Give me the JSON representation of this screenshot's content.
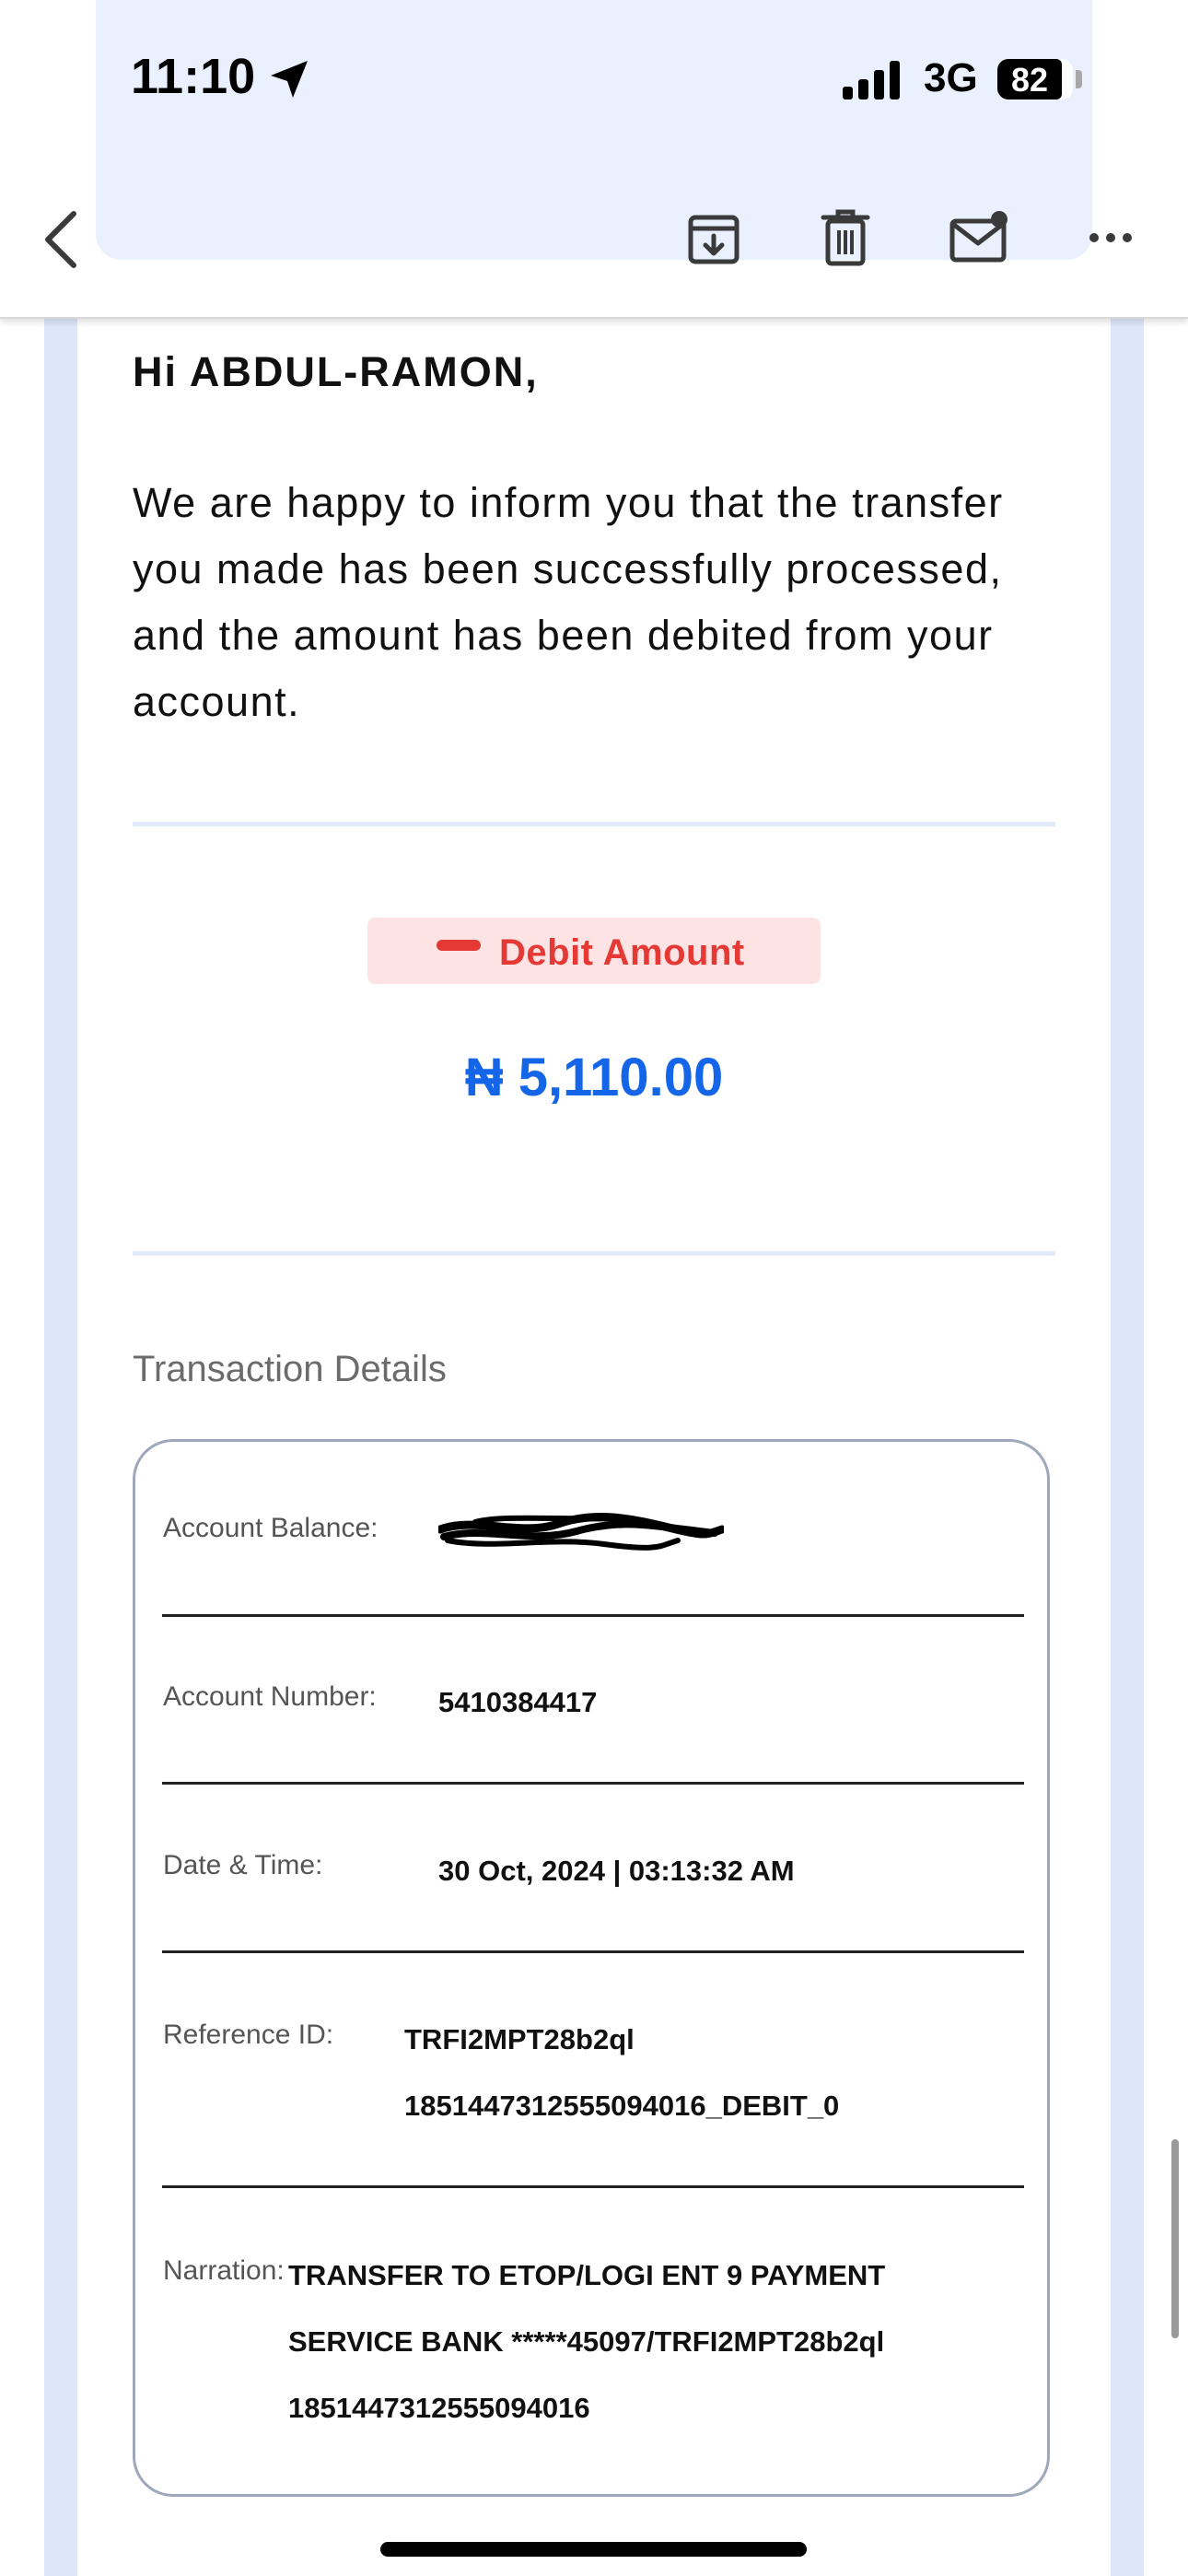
{
  "status_bar": {
    "time": "11:10",
    "network": "3G",
    "battery": "82"
  },
  "toolbar": {
    "back_icon": "chevron-left-icon",
    "archive_icon": "archive-icon",
    "trash_icon": "trash-icon",
    "mark_unread_icon": "mail-unread-icon",
    "more_icon": "more-icon"
  },
  "email": {
    "greeting": "Hi ABDUL-RAMON,",
    "intro": "We are happy to inform you that the transfer you made has been successfully processed, and the amount has been debited from your account.",
    "debit_label": "Debit Amount",
    "amount": "₦ 5,110.00",
    "section_title": "Transaction Details",
    "details": {
      "balance_label": "Account Balance:",
      "account_number_label": "Account Number:",
      "account_number": "5410384417",
      "datetime_label": "Date & Time:",
      "datetime": "30 Oct, 2024 | 03:13:32 AM",
      "reference_label": "Reference ID:",
      "reference_line1": "TRFI2MPT28b2ql",
      "reference_line2": "1851447312555094016_DEBIT_0",
      "narration_label": "Narration:",
      "narration_line1": "TRANSFER TO ETOP/LOGI ENT 9 PAYMENT",
      "narration_line2": "SERVICE BANK *****45097/TRFI2MPT28b2ql",
      "narration_line3": "1851447312555094016"
    }
  },
  "colors": {
    "accent_blue": "#1565e8",
    "debit_red": "#e53935",
    "debit_pill_bg": "#fde3e3",
    "backdrop": "#dde7fb"
  }
}
